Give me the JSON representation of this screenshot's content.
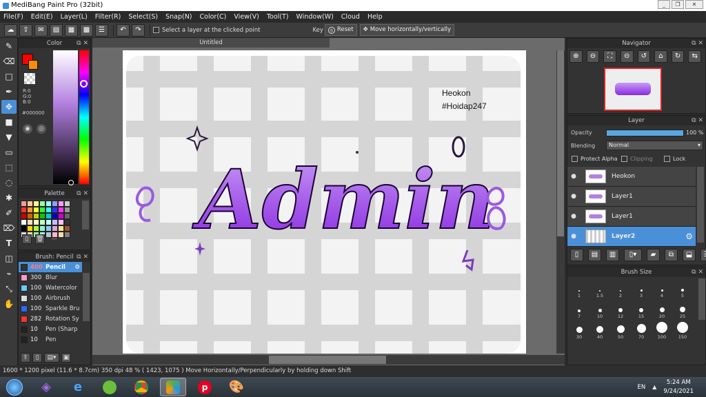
{
  "window": {
    "title": "MediBang Paint Pro (32bit)"
  },
  "menu": [
    "File(F)",
    "Edit(E)",
    "Layer(L)",
    "Filter(R)",
    "Select(S)",
    "Snap(N)",
    "Color(C)",
    "View(V)",
    "Tool(T)",
    "Window(W)",
    "Cloud",
    "Help"
  ],
  "toolbar": {
    "select_layer_label": "Select a layer at the clicked point",
    "key_label": "Key",
    "reset_label": "Reset",
    "move_label": "Move horizontally/vertically"
  },
  "color_panel": {
    "title": "Color",
    "r": "R:0",
    "g": "G:0",
    "b": "B:0",
    "hex": "#000000",
    "fg_color": "#ff0000",
    "bg_color": "#ff8c00"
  },
  "palette_panel": {
    "title": "Palette",
    "swatches": [
      "#ff9999",
      "#ffcc99",
      "#ffff99",
      "#99ff99",
      "#99ffff",
      "#9999ff",
      "#ff99ff",
      "#cccccc",
      "#ff3333",
      "#ff9933",
      "#ffff33",
      "#33ff33",
      "#33ffff",
      "#3333ff",
      "#ff33ff",
      "#999999",
      "#cc0000",
      "#cc6600",
      "#cccc00",
      "#00cc00",
      "#00cccc",
      "#0000cc",
      "#cc00cc",
      "#666666",
      "#ffffff",
      "#ffe0c0",
      "#ffffc0",
      "#c0ffc0",
      "#c0ffff",
      "#c0c0ff",
      "#ffc0ff",
      "#333333",
      "#000000",
      "#ffd700",
      "#adff2f",
      "#7fffd4",
      "#87ceeb",
      "#dda0dd",
      "#f0e68c",
      "#a0522d",
      "#e0e0e0",
      "#f5deb3",
      "#98fb98",
      "#afeeee",
      "#b0c4de",
      "#ffb6c1",
      "#ffdab9",
      "#808080"
    ],
    "extra": "---"
  },
  "brush_panel": {
    "title": "Brush: Pencil",
    "brushes": [
      {
        "size": "400",
        "name": "Pencil",
        "color": "#333333",
        "selected": true
      },
      {
        "size": "300",
        "name": "Blur",
        "color": "#ff99cc"
      },
      {
        "size": "100",
        "name": "Watercolor",
        "color": "#66ccff"
      },
      {
        "size": "100",
        "name": "Airbrush",
        "color": "#dddddd"
      },
      {
        "size": "100",
        "name": "Sparkle Bru",
        "color": "#3366ff"
      },
      {
        "size": "282",
        "name": "Rotation Sy",
        "color": "#ff3333"
      },
      {
        "size": "10",
        "name": "Pen (Sharp",
        "color": "#222222"
      },
      {
        "size": "10",
        "name": "Pen",
        "color": "#222222"
      }
    ]
  },
  "document": {
    "tab_title": "Untitled",
    "text_line1": "Heokon",
    "text_line2": "#Hoidap247",
    "word": "Admin"
  },
  "navigator": {
    "title": "Navigator"
  },
  "layer_panel": {
    "title": "Layer",
    "opacity_label": "Opacity",
    "opacity_value": "100 %",
    "opacity_fraction": 1.0,
    "blending_label": "Blending",
    "blending_value": "Normal",
    "protect_alpha": "Protect Alpha",
    "clipping": "Clipping",
    "lock": "Lock",
    "layers": [
      {
        "name": "Heokon",
        "selected": false
      },
      {
        "name": "Layer1",
        "selected": false
      },
      {
        "name": "Layer1",
        "selected": false
      },
      {
        "name": "Layer2",
        "selected": true
      }
    ]
  },
  "brush_size_panel": {
    "title": "Brush Size",
    "sizes": [
      "1",
      "1.5",
      "2",
      "3",
      "4",
      "5",
      "7",
      "10",
      "12",
      "15",
      "20",
      "25",
      "30",
      "40",
      "50",
      "70",
      "100",
      "150"
    ]
  },
  "status": {
    "text": "1600 * 1200 pixel  (11.6 * 8.7cm)  350 dpi  48 %  ( 1423, 1075 )  Move Horizontally/Perpendicularly by holding down Shift"
  },
  "taskbar": {
    "lang": "EN",
    "time": "5:24 AM",
    "date": "9/24/2021"
  }
}
